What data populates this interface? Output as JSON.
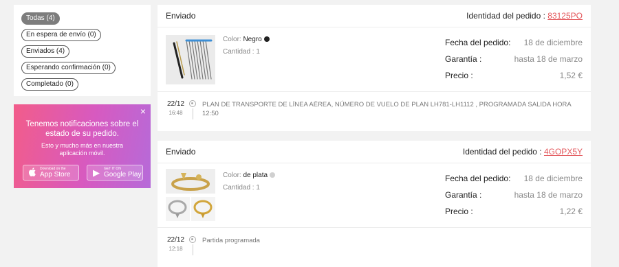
{
  "filters": [
    {
      "label": "Todas (4)",
      "active": true
    },
    {
      "label": "En espera de envío (0)",
      "active": false
    },
    {
      "label": "Enviados (4)",
      "active": false
    },
    {
      "label": "Esperando confirmación (0)",
      "active": false
    },
    {
      "label": "Completado (0)",
      "active": false
    }
  ],
  "promo": {
    "close_icon": "×",
    "title": "Tenemos notificaciones sobre el estado de su pedido.",
    "subtitle": "Esto y mucho más en nuestra aplicación móvil.",
    "app_store": {
      "small": "Download on the",
      "big": "App Store",
      "icon": ""
    },
    "google_play": {
      "small": "GET IT ON",
      "big": "Google Play",
      "icon": "▶"
    }
  },
  "orders": [
    {
      "status": "Enviado",
      "id_label": "Identidad del pedido : ",
      "id": "83125PO",
      "color_label": "Color: ",
      "color_value": "Negro",
      "color_hex": "#222222",
      "qty_label": "Cantidad : ",
      "qty": "1",
      "fecha_label": "Fecha del pedido:",
      "fecha": "18 de diciembre",
      "garantia_label": "Garantía :",
      "garantia": "hasta 18 de marzo",
      "precio_label": "Precio :",
      "precio": "1,52 €",
      "track_day": "22/12",
      "track_time": "16:48",
      "track_msg": "PLAN DE TRANSPORTE DE LÍNEA AÉREA, NÚMERO DE VUELO DE PLAN LH781-LH1112 , PROGRAMADA SALIDA HORA 12:50"
    },
    {
      "status": "Enviado",
      "id_label": "Identidad del pedido : ",
      "id": "4GOPX5Y",
      "color_label": "Color: ",
      "color_value": "de plata",
      "color_hex": "#d0d0d0",
      "qty_label": "Cantidad : ",
      "qty": "1",
      "fecha_label": "Fecha del pedido:",
      "fecha": "18 de diciembre",
      "garantia_label": "Garantía :",
      "garantia": "hasta 18 de marzo",
      "precio_label": "Precio :",
      "precio": "1,22 €",
      "track_day": "22/12",
      "track_time": "12:18",
      "track_msg": "Partida programada"
    }
  ]
}
